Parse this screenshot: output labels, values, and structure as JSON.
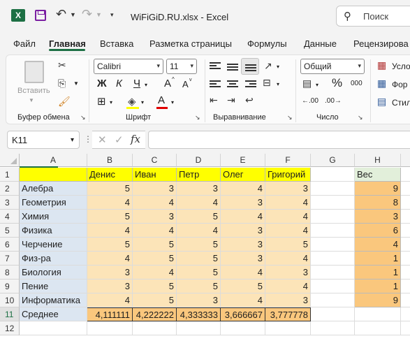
{
  "titlebar": {
    "logo": "X",
    "file_title": "WiFiGiD.RU.xlsx  -  Excel",
    "search_placeholder": "Поиск",
    "undo_icon": "undo-icon",
    "redo_icon": "redo-icon"
  },
  "tabs": [
    "Файл",
    "Главная",
    "Вставка",
    "Разметка страницы",
    "Формулы",
    "Данные",
    "Рецензирова"
  ],
  "active_tab": "Главная",
  "ribbon": {
    "clipboard": {
      "paste_label": "Вставить",
      "group_label": "Буфер обмена"
    },
    "font": {
      "font_name": "Calibri",
      "font_size": "11",
      "group_label": "Шрифт",
      "bold": "Ж",
      "italic": "К",
      "underline": "Ч",
      "grow": "A",
      "shrink": "A",
      "font_color": "A"
    },
    "alignment": {
      "group_label": "Выравнивание"
    },
    "number": {
      "format": "Общий",
      "percent": "%",
      "thousands": "000",
      "dec_inc": "←.00",
      "dec_dec": ".00→",
      "group_label": "Число"
    },
    "styles": {
      "conditional": "Усло",
      "format_table": "Фор",
      "cell_styles": "Стил"
    }
  },
  "formula_bar": {
    "name_box": "K11",
    "fx": "fx",
    "formula": ""
  },
  "columns": [
    "A",
    "B",
    "C",
    "D",
    "E",
    "F",
    "G",
    "H",
    "I"
  ],
  "rows": [
    "1",
    "2",
    "3",
    "4",
    "5",
    "6",
    "7",
    "8",
    "9",
    "10",
    "11",
    "12"
  ],
  "selected_cell": "K11",
  "sheet": {
    "headers": [
      "",
      "Денис",
      "Иван",
      "Петр",
      "Олег",
      "Григорий"
    ],
    "subjects": [
      "Алебра",
      "Геометрия",
      "Химия",
      "Физика",
      "Черчение",
      "Физ-ра",
      "Биология",
      "Пение",
      "Информатика"
    ],
    "grades": [
      [
        5,
        3,
        3,
        4,
        3
      ],
      [
        4,
        4,
        4,
        3,
        4
      ],
      [
        5,
        3,
        5,
        4,
        4
      ],
      [
        4,
        4,
        4,
        3,
        4
      ],
      [
        5,
        5,
        5,
        3,
        5
      ],
      [
        4,
        5,
        5,
        3,
        4
      ],
      [
        3,
        4,
        5,
        4,
        3
      ],
      [
        3,
        5,
        5,
        5,
        4
      ],
      [
        4,
        5,
        3,
        4,
        3
      ]
    ],
    "average_label": "Среднее",
    "averages": [
      "4,111111",
      "4,222222",
      "4,333333",
      "3,666667",
      "3,777778"
    ],
    "weight_header": "Вес",
    "weights": [
      9,
      8,
      3,
      6,
      4,
      1,
      1,
      1,
      9
    ]
  },
  "colors": {
    "excel_green": "#1d7044",
    "header_yellow": "#ffff00",
    "subject_blue": "#dce6f1",
    "grade_light_orange": "#fce4b8",
    "average_orange": "#fac77d"
  }
}
